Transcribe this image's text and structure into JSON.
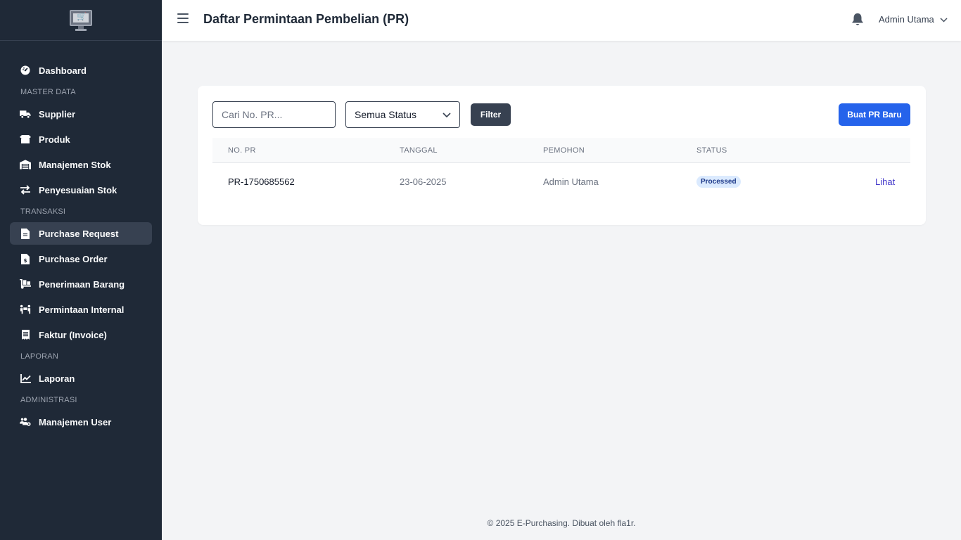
{
  "topbar": {
    "title": "Daftar Permintaan Pembelian (PR)",
    "user_name": "Admin Utama"
  },
  "sidebar": {
    "items": [
      {
        "type": "item",
        "label": "Dashboard",
        "icon": "dashboard-icon"
      },
      {
        "type": "section",
        "label": "MASTER DATA"
      },
      {
        "type": "item",
        "label": "Supplier",
        "icon": "truck-icon"
      },
      {
        "type": "item",
        "label": "Produk",
        "icon": "box-icon"
      },
      {
        "type": "item",
        "label": "Manajemen Stok",
        "icon": "warehouse-icon"
      },
      {
        "type": "item",
        "label": "Penyesuaian Stok",
        "icon": "exchange-icon"
      },
      {
        "type": "section",
        "label": "TRANSAKSI"
      },
      {
        "type": "item",
        "label": "Purchase Request",
        "icon": "file-icon",
        "active": true
      },
      {
        "type": "item",
        "label": "Purchase Order",
        "icon": "file-invoice-icon"
      },
      {
        "type": "item",
        "label": "Penerimaan Barang",
        "icon": "dolly-icon"
      },
      {
        "type": "item",
        "label": "Permintaan Internal",
        "icon": "people-carry-icon"
      },
      {
        "type": "item",
        "label": "Faktur (Invoice)",
        "icon": "receipt-icon"
      },
      {
        "type": "section",
        "label": "LAPORAN"
      },
      {
        "type": "item",
        "label": "Laporan",
        "icon": "chart-line-icon"
      },
      {
        "type": "section",
        "label": "ADMINISTRASI"
      },
      {
        "type": "item",
        "label": "Manajemen User",
        "icon": "users-cog-icon"
      }
    ]
  },
  "filters": {
    "search_placeholder": "Cari No. PR...",
    "status_selected": "Semua Status",
    "filter_label": "Filter",
    "new_button_label": "Buat PR Baru"
  },
  "table": {
    "headers": [
      "NO. PR",
      "TANGGAL",
      "PEMOHON",
      "STATUS"
    ],
    "rows": [
      {
        "no_pr": "PR-1750685562",
        "tanggal": "23-06-2025",
        "pemohon": "Admin Utama",
        "status": "Processed",
        "action": "Lihat"
      }
    ]
  },
  "footer": {
    "text": "© 2025 E-Purchasing. Dibuat oleh fla1r."
  },
  "colors": {
    "sidebar_bg": "#1f2937",
    "primary": "#2563eb",
    "badge_bg": "#dbeafe"
  }
}
